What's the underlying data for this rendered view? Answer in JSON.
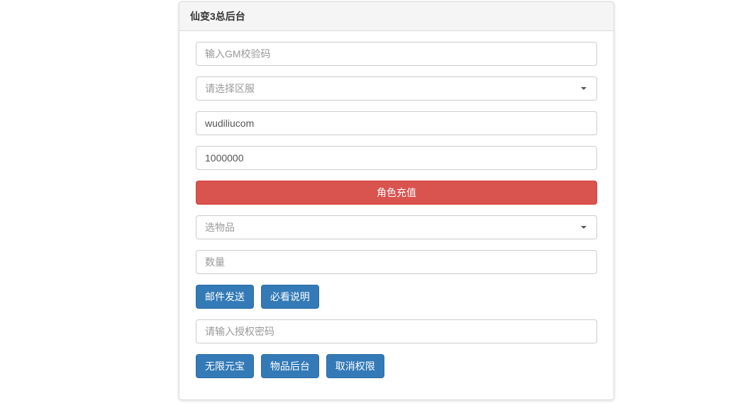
{
  "panel": {
    "title": "仙变3总后台"
  },
  "form": {
    "gm_code_placeholder": "输入GM校验码",
    "server_select_placeholder": "请选择区服",
    "username_value": "wudiliucom",
    "amount_value": "1000000",
    "recharge_button": "角色充值",
    "item_select_placeholder": "选物品",
    "quantity_placeholder": "数量",
    "mail_send_button": "邮件发送",
    "must_read_button": "必看说明",
    "auth_password_placeholder": "请输入授权密码",
    "unlimited_yuanbao_button": "无限元宝",
    "item_backend_button": "物品后台",
    "cancel_permission_button": "取消权限"
  }
}
